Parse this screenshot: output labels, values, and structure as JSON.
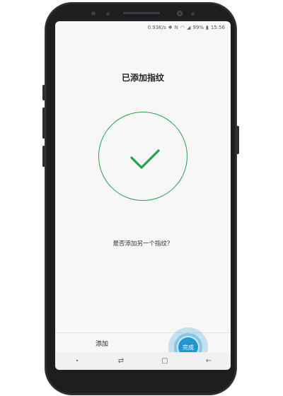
{
  "status_bar": {
    "speed": "0.93K/s",
    "battery": "99%",
    "time": "15:56",
    "icons": [
      "bluetooth-icon",
      "nfc-icon",
      "wifi-icon",
      "signal-icon",
      "battery-icon"
    ]
  },
  "screen": {
    "title": "已添加指纹",
    "question": "是否添加另一个指纹？",
    "check_color": "#22a24c"
  },
  "actions": {
    "add_label": "添加",
    "done_label": "完成",
    "done_color": "#2196d6"
  },
  "nav": {
    "dot": "•",
    "recent": "⇄",
    "home": "▢",
    "back": "←"
  }
}
